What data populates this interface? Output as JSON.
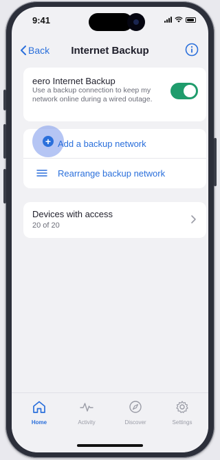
{
  "status": {
    "time": "9:41"
  },
  "nav": {
    "back_label": "Back",
    "title": "Internet Backup"
  },
  "backup": {
    "title": "eero Internet Backup",
    "description": "Use a backup connection to keep my network online during a wired outage.",
    "enabled": true
  },
  "actions": {
    "add_label": "Add a backup network",
    "rearrange_label": "Rearrange backup network"
  },
  "devices": {
    "title": "Devices with access",
    "count": "20 of 20"
  },
  "tabs": [
    {
      "label": "Home",
      "icon": "home-icon",
      "active": true
    },
    {
      "label": "Activity",
      "icon": "activity-icon",
      "active": false
    },
    {
      "label": "Discover",
      "icon": "compass-icon",
      "active": false
    },
    {
      "label": "Settings",
      "icon": "gear-icon",
      "active": false
    }
  ],
  "colors": {
    "accent": "#2a6fdb",
    "toggle_on": "#1f9c6c"
  }
}
